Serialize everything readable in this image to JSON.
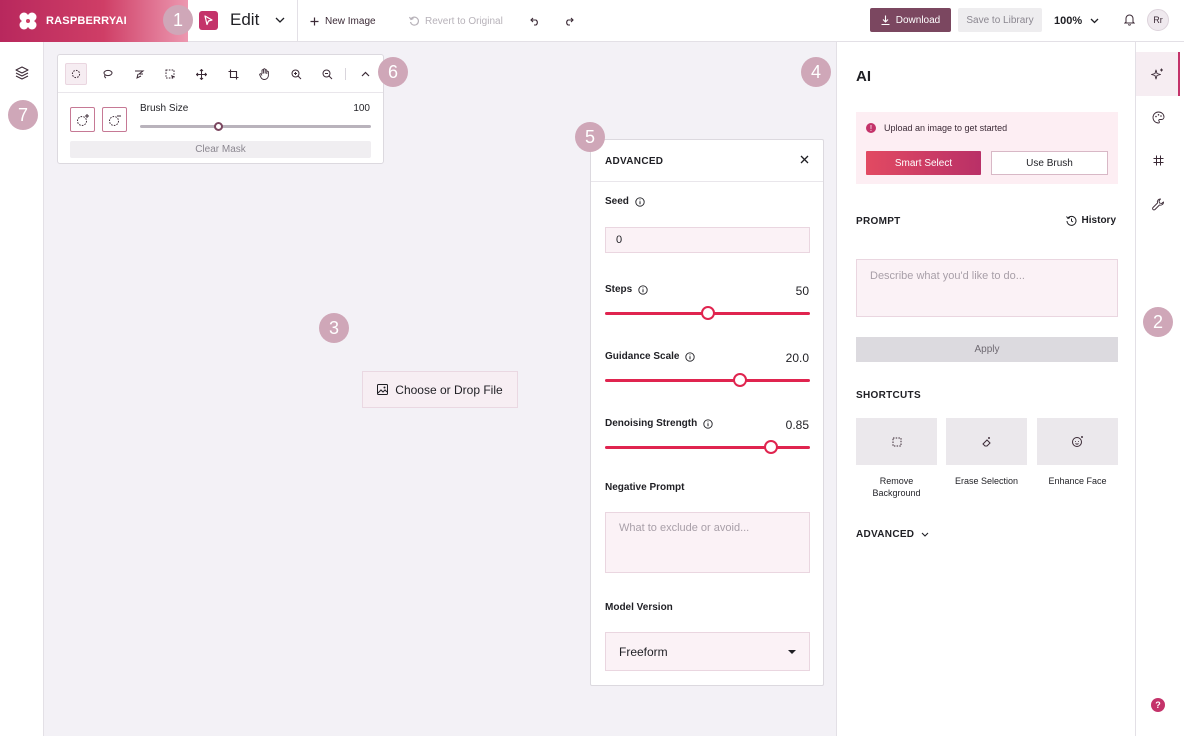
{
  "header": {
    "brand": "RASPBERRYAI",
    "mode_label": "Edit",
    "new_image": "New Image",
    "revert": "Revert to Original",
    "download": "Download",
    "save_to_library": "Save to Library",
    "zoom": "100%",
    "avatar_initials": "Rr"
  },
  "callouts": [
    "1",
    "2",
    "3",
    "4",
    "5",
    "6",
    "7"
  ],
  "toolbar": {
    "tools": [
      "select-icon",
      "lasso-icon",
      "pen-lasso-icon",
      "rect-select-icon",
      "move-icon",
      "crop-icon",
      "hand-icon",
      "zoom-in-icon",
      "zoom-out-icon",
      "collapse-icon"
    ],
    "brush_size_label": "Brush Size",
    "brush_size_value": "100",
    "brush_size_fraction": 0.34,
    "clear_mask": "Clear Mask"
  },
  "canvas": {
    "choose_file": "Choose or Drop File"
  },
  "advanced": {
    "title": "ADVANCED",
    "seed_label": "Seed",
    "seed_value": "0",
    "steps_label": "Steps",
    "steps_value": "50",
    "steps_fraction": 0.5,
    "guidance_label": "Guidance Scale",
    "guidance_value": "20.0",
    "guidance_fraction": 0.66,
    "denoise_label": "Denoising Strength",
    "denoise_value": "0.85",
    "denoise_fraction": 0.81,
    "negative_prompt_label": "Negative Prompt",
    "negative_prompt_placeholder": "What to exclude or avoid...",
    "model_label": "Model Version",
    "model_value": "Freeform"
  },
  "ai": {
    "title": "AI",
    "notice": "Upload an image to get started",
    "smart_select": "Smart Select",
    "use_brush": "Use Brush",
    "prompt_label": "PROMPT",
    "history": "History",
    "prompt_placeholder": "Describe what you'd like to do...",
    "apply": "Apply",
    "shortcuts_label": "SHORTCUTS",
    "shortcuts": [
      {
        "label": "Remove Background",
        "icon": "dashed-square-icon"
      },
      {
        "label": "Erase Selection",
        "icon": "eraser-icon"
      },
      {
        "label": "Enhance Face",
        "icon": "face-sparkle-icon"
      }
    ],
    "advanced_toggle": "ADVANCED"
  },
  "colors": {
    "accent": "#c4336a",
    "slider": "#e0244f",
    "download_bg": "#7b4760"
  }
}
